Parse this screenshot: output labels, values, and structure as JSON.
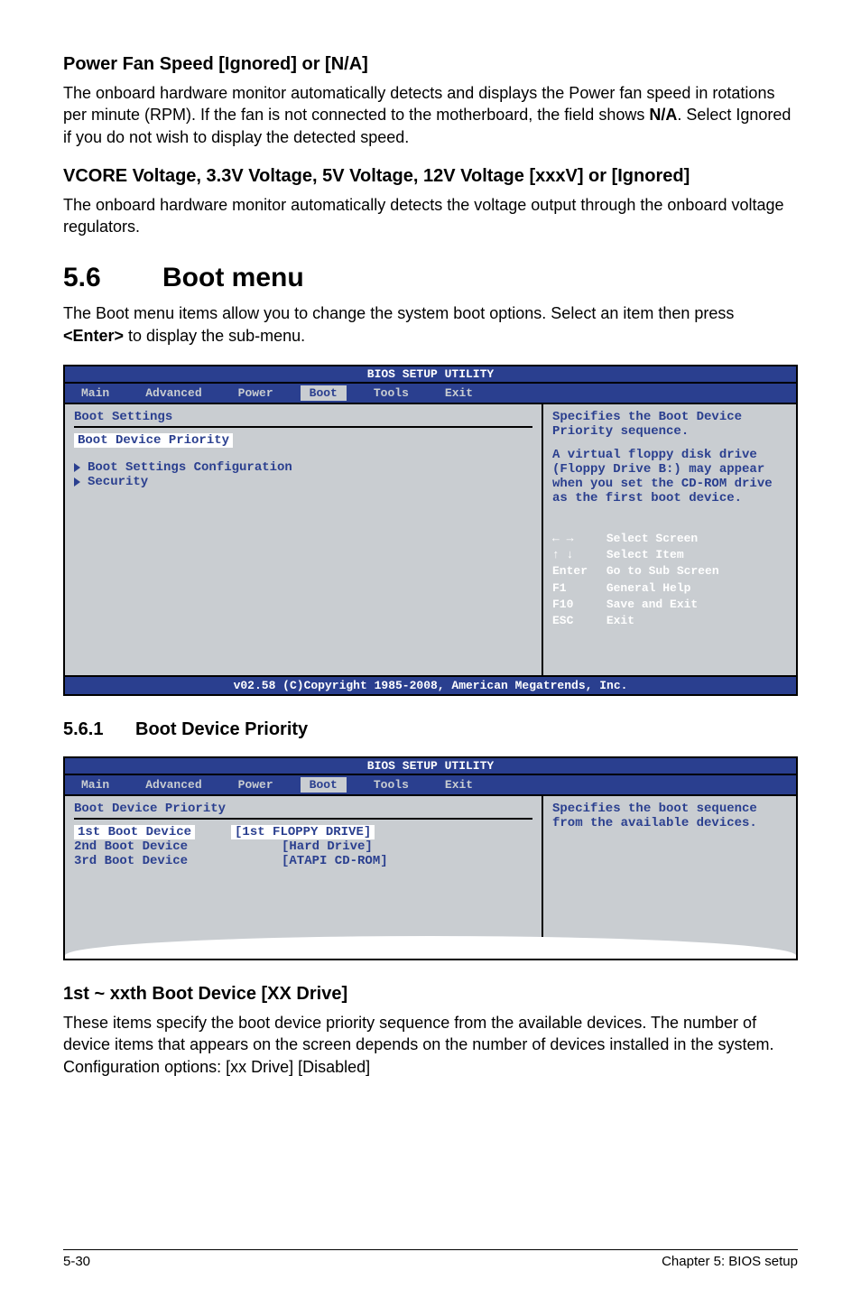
{
  "sec1": {
    "title": "Power Fan Speed [Ignored] or [N/A]",
    "text_pre": "The onboard hardware monitor automatically detects and displays the Power fan speed in rotations per minute (RPM). If the fan is not connected to the motherboard, the field shows ",
    "bold": "N/A",
    "text_post": ". Select Ignored if you do not wish to display the detected speed."
  },
  "sec2": {
    "title": " VCORE Voltage, 3.3V Voltage, 5V Voltage, 12V Voltage [xxxV] or [Ignored]",
    "text": "The onboard hardware monitor automatically detects the voltage output through the onboard voltage regulators."
  },
  "chapter": {
    "num": "5.6",
    "title": "Boot menu",
    "intro_pre": "The Boot menu items allow you to change the system boot options. Select an item then press ",
    "intro_bold": "<Enter>",
    "intro_post": " to display the sub-menu."
  },
  "bios1": {
    "title": "BIOS SETUP UTILITY",
    "tabs": [
      "Main",
      "Advanced",
      "Power",
      "Boot",
      "Tools",
      "Exit"
    ],
    "selected_tab": "Boot",
    "heading": "Boot Settings",
    "selected_item": "Boot Device Priority",
    "sub_items": [
      "Boot Settings Configuration",
      "Security"
    ],
    "help_p1": "Specifies the Boot Device Priority sequence.",
    "help_p2": "A virtual floppy disk drive (Floppy Drive B:) may appear when you set the CD-ROM drive as the first boot device.",
    "keys": [
      {
        "key_type": "lr",
        "desc": "Select Screen"
      },
      {
        "key_type": "ud",
        "desc": "Select Item"
      },
      {
        "key": "Enter",
        "desc": "Go to Sub Screen"
      },
      {
        "key": "F1",
        "desc": "General Help"
      },
      {
        "key": "F10",
        "desc": "Save and Exit"
      },
      {
        "key": "ESC",
        "desc": "Exit"
      }
    ],
    "footer": "v02.58 (C)Copyright 1985-2008, American Megatrends, Inc."
  },
  "subsec": {
    "num": "5.6.1",
    "title": "Boot Device Priority"
  },
  "bios2": {
    "title": "BIOS SETUP UTILITY",
    "tabs": [
      "Main",
      "Advanced",
      "Power",
      "Boot",
      "Tools",
      "Exit"
    ],
    "selected_tab": "Boot",
    "heading": "Boot Device Priority",
    "rows": [
      {
        "label": "1st Boot Device",
        "value": "[1st FLOPPY DRIVE]",
        "selected": true
      },
      {
        "label": "2nd Boot Device",
        "value": "[Hard Drive]",
        "selected": false
      },
      {
        "label": "3rd Boot Device",
        "value": "[ATAPI CD-ROM]",
        "selected": false
      }
    ],
    "help": "Specifies the boot sequence from the available devices."
  },
  "sec3": {
    "title": "1st ~ xxth Boot Device [XX Drive]",
    "text": "These items specify the boot device priority sequence from the available devices. The number of device items that appears on the screen depends on the number of devices installed in the system. Configuration options: [xx Drive] [Disabled]"
  },
  "footer": {
    "left": "5-30",
    "right": "Chapter 5: BIOS setup"
  }
}
